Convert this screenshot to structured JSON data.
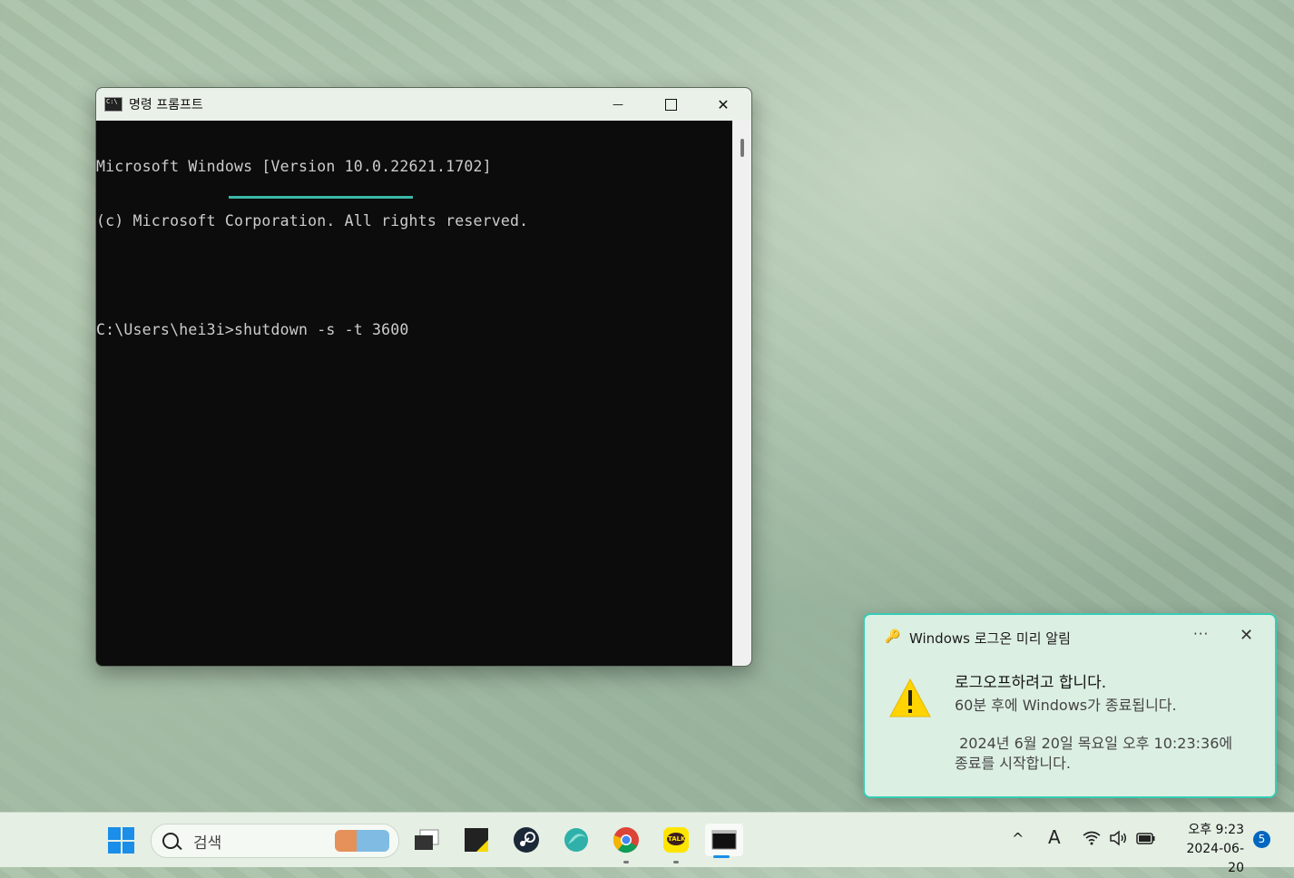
{
  "cmd_window": {
    "title": "명령 프롬프트",
    "minimize": "—",
    "close": "✕",
    "lines": [
      "Microsoft Windows [Version 10.0.22621.1702]",
      "(c) Microsoft Corporation. All rights reserved.",
      "",
      "C:\\Users\\hei3i>shutdown -s -t 3600"
    ]
  },
  "toast": {
    "app_name": "Windows 로그온 미리 알림",
    "more": "···",
    "close": "✕",
    "title": "로그오프하려고 합니다.",
    "body": "60분 후에 Windows가 종료됩니다.",
    "body2": " 2024년 6월 20일 목요일 오후 10:23:36에\n종료를 시작합니다."
  },
  "taskbar": {
    "search_placeholder": "검색",
    "apps": [
      "task-view",
      "sticky-notes",
      "steam",
      "edge-like",
      "chrome",
      "kakaotalk",
      "command-prompt"
    ],
    "kakaotalk_label": "TALK",
    "tray": {
      "chevron": "^",
      "ime": "A"
    },
    "clock_time": "오후 9:23",
    "clock_date": "2024-06-20",
    "notification_count": "5"
  },
  "colors": {
    "accent": "#35cdb6",
    "windows_blue": "#1a8ee8",
    "console_bg": "#0c0c0c"
  }
}
